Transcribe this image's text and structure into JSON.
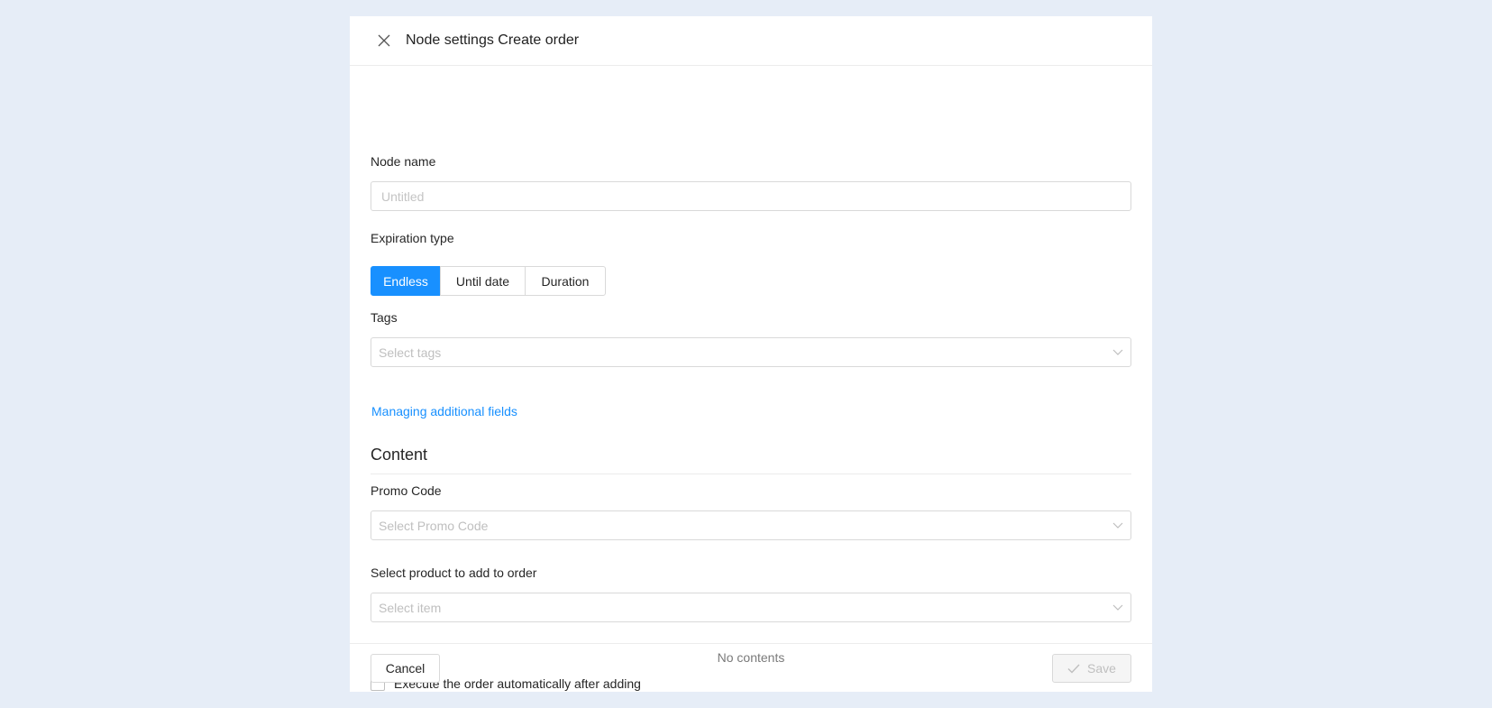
{
  "header": {
    "title": "Node settings Create order",
    "close_icon": "close-icon"
  },
  "form": {
    "node_name": {
      "label": "Node name",
      "placeholder": "Untitled",
      "value": ""
    },
    "expiration": {
      "label": "Expiration type",
      "options": [
        "Endless",
        "Until date",
        "Duration"
      ],
      "selected": "Endless"
    },
    "tags": {
      "label": "Tags",
      "placeholder": "Select tags"
    },
    "manage_link": "Managing additional fields"
  },
  "content": {
    "heading": "Content",
    "promo_code": {
      "label": "Promo Code",
      "placeholder": "Select Promo Code"
    },
    "product": {
      "label": "Select product to add to order",
      "placeholder": "Select item"
    },
    "empty_text": "No contents",
    "auto_execute": {
      "label": "Execute the order automatically after adding",
      "checked": false
    }
  },
  "footer": {
    "cancel_label": "Cancel",
    "save_label": "Save"
  },
  "colors": {
    "background": "#e6edf7",
    "accent": "#1890ff",
    "border": "#d9d9d9"
  }
}
